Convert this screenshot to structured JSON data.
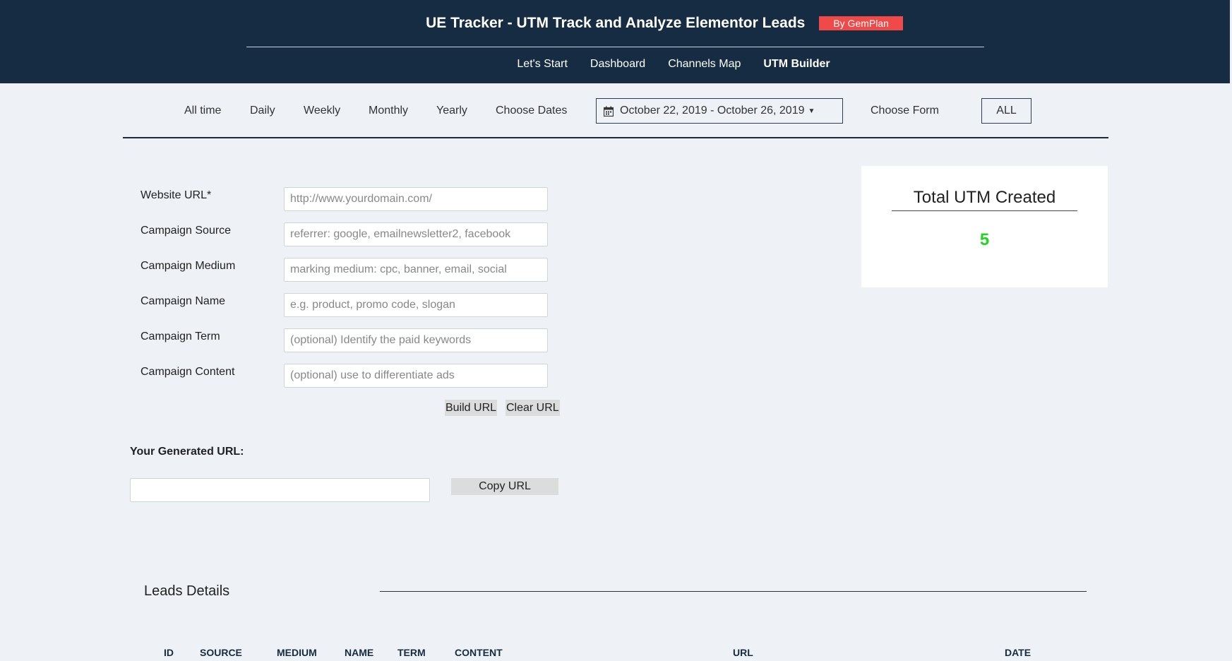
{
  "header": {
    "title": "UE Tracker - UTM Track and Analyze Elementor Leads",
    "badge": "By GemPlan",
    "nav": [
      "Let's Start",
      "Dashboard",
      "Channels Map",
      "UTM Builder"
    ],
    "active_nav": "UTM Builder"
  },
  "filters": {
    "periods": [
      "All time",
      "Daily",
      "Weekly",
      "Monthly",
      "Yearly",
      "Choose Dates"
    ],
    "date_range": "October 22, 2019 - October 26, 2019",
    "choose_form_label": "Choose Form",
    "form_value": "ALL"
  },
  "builder": {
    "fields": [
      {
        "label": "Website URL*",
        "placeholder": "http://www.yourdomain.com/"
      },
      {
        "label": "Campaign Source",
        "placeholder": "referrer: google, emailnewsletter2, facebook"
      },
      {
        "label": "Campaign Medium",
        "placeholder": "marking medium: cpc, banner, email, social"
      },
      {
        "label": "Campaign Name",
        "placeholder": "e.g. product, promo code, slogan"
      },
      {
        "label": "Campaign Term",
        "placeholder": "(optional) Identify the paid keywords"
      },
      {
        "label": "Campaign Content",
        "placeholder": "(optional) use to differentiate ads"
      }
    ],
    "build_label": "Build URL",
    "clear_label": "Clear URL",
    "generated_label": "Your Generated URL:",
    "generated_value": "",
    "copy_label": "Copy URL"
  },
  "stats": {
    "title": "Total UTM Created",
    "value": "5"
  },
  "leads": {
    "title": "Leads Details",
    "columns": [
      "ID",
      "SOURCE",
      "MEDIUM",
      "NAME",
      "TERM",
      "CONTENT",
      "URL",
      "DATE"
    ]
  },
  "colors": {
    "header_bg": "#152c42",
    "badge_bg": "#f04a48",
    "page_bg": "#eef1f5",
    "total_value": "#1fd61f"
  }
}
